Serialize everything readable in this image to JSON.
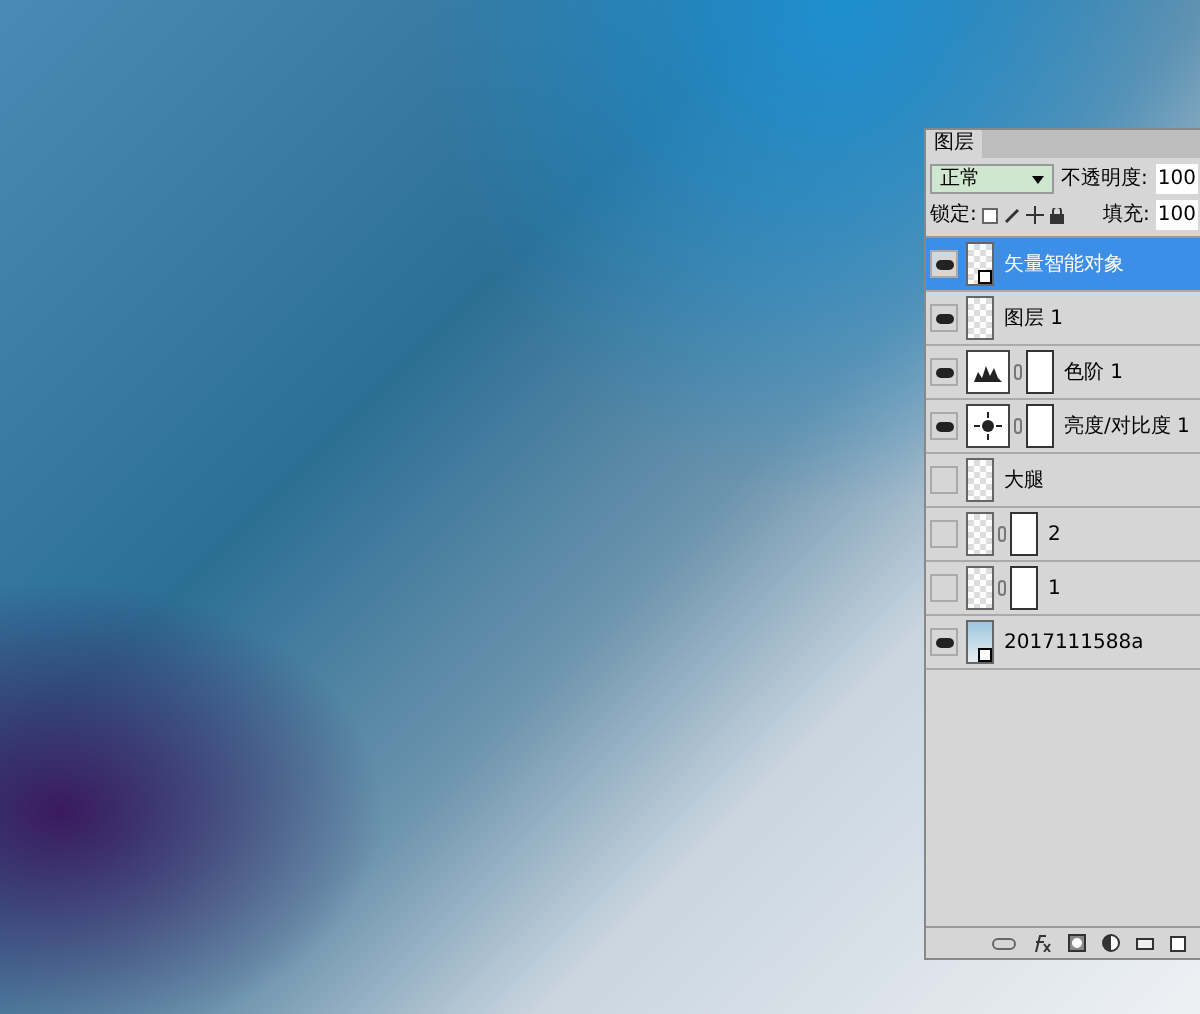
{
  "panel": {
    "tab": "图层",
    "blend_mode": "正常",
    "opacity_label": "不透明度:",
    "opacity_value": "100",
    "lock_label": "锁定:",
    "fill_label": "填充:",
    "fill_value": "100"
  },
  "layers": [
    {
      "name": "矢量智能对象",
      "visible": true,
      "selected": true,
      "kind": "smart"
    },
    {
      "name": "图层 1",
      "visible": true,
      "selected": false,
      "kind": "normal"
    },
    {
      "name": "色阶 1",
      "visible": true,
      "selected": false,
      "kind": "levels"
    },
    {
      "name": "亮度/对比度 1",
      "visible": true,
      "selected": false,
      "kind": "brightness"
    },
    {
      "name": "大腿",
      "visible": false,
      "selected": false,
      "kind": "normal"
    },
    {
      "name": "2",
      "visible": false,
      "selected": false,
      "kind": "masked"
    },
    {
      "name": "1",
      "visible": false,
      "selected": false,
      "kind": "masked"
    },
    {
      "name": "2017111588a",
      "visible": true,
      "selected": false,
      "kind": "photo"
    }
  ]
}
